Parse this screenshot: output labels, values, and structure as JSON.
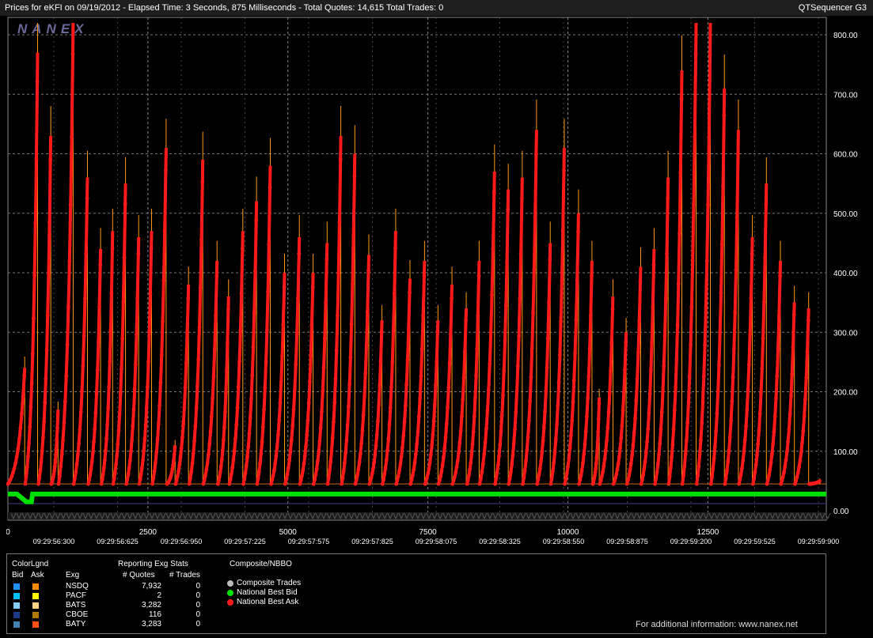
{
  "header": {
    "title": "Prices for  eKFI  on  09/19/2012  -  Elapsed Time: 3 Seconds, 875 Milliseconds  -  Total Quotes: 14,615  Total Trades: 0",
    "app": "QTSequencer G3"
  },
  "brand": {
    "logo": "NANEX"
  },
  "chart_data": {
    "type": "line",
    "title": "",
    "xlabel": "",
    "ylabel": "",
    "ylim": [
      0,
      820
    ],
    "xlim": [
      0,
      14615
    ],
    "yticks": [
      "0.00",
      "100.00",
      "200.00",
      "300.00",
      "400.00",
      "500.00",
      "600.00",
      "700.00",
      "800.00"
    ],
    "xticks_top": [
      "0",
      "2500",
      "5000",
      "7500",
      "10000",
      "12500"
    ],
    "xticks_time": [
      "09:29:56:300",
      "09:29:56:625",
      "09:29:56:950",
      "09:29:57:225",
      "09:29:57:575",
      "09:29:57:825",
      "09:29:58:075",
      "09:29:58:325",
      "09:29:58:550",
      "09:29:58:875",
      "09:29:59:200",
      "09:29:59:525",
      "09:29:59:900"
    ],
    "series": [
      {
        "name": "National Best Ask",
        "color": "#ff1a1a",
        "note_type": "sawtooth",
        "cycles": [
          {
            "start": 0,
            "end": 300,
            "peak": 240
          },
          {
            "start": 310,
            "end": 530,
            "peak": 770
          },
          {
            "start": 545,
            "end": 765,
            "peak": 630
          },
          {
            "start": 775,
            "end": 895,
            "peak": 170
          },
          {
            "start": 905,
            "end": 1165,
            "peak": 820
          },
          {
            "start": 1175,
            "end": 1420,
            "peak": 560
          },
          {
            "start": 1435,
            "end": 1655,
            "peak": 440
          },
          {
            "start": 1670,
            "end": 1870,
            "peak": 470
          },
          {
            "start": 1880,
            "end": 2100,
            "peak": 550
          },
          {
            "start": 2115,
            "end": 2335,
            "peak": 460
          },
          {
            "start": 2345,
            "end": 2565,
            "peak": 470
          },
          {
            "start": 2580,
            "end": 2825,
            "peak": 610
          },
          {
            "start": 2840,
            "end": 2985,
            "peak": 110
          },
          {
            "start": 2995,
            "end": 3225,
            "peak": 380
          },
          {
            "start": 3240,
            "end": 3480,
            "peak": 590
          },
          {
            "start": 3490,
            "end": 3735,
            "peak": 420
          },
          {
            "start": 3750,
            "end": 3940,
            "peak": 360
          },
          {
            "start": 3955,
            "end": 4195,
            "peak": 470
          },
          {
            "start": 4205,
            "end": 4440,
            "peak": 520
          },
          {
            "start": 4450,
            "end": 4685,
            "peak": 580
          },
          {
            "start": 4700,
            "end": 4940,
            "peak": 400
          },
          {
            "start": 4950,
            "end": 5205,
            "peak": 460
          },
          {
            "start": 5215,
            "end": 5450,
            "peak": 400
          },
          {
            "start": 5460,
            "end": 5700,
            "peak": 450
          },
          {
            "start": 5710,
            "end": 5945,
            "peak": 630
          },
          {
            "start": 5960,
            "end": 6195,
            "peak": 600
          },
          {
            "start": 6205,
            "end": 6445,
            "peak": 430
          },
          {
            "start": 6455,
            "end": 6680,
            "peak": 320
          },
          {
            "start": 6690,
            "end": 6925,
            "peak": 470
          },
          {
            "start": 6935,
            "end": 7180,
            "peak": 390
          },
          {
            "start": 7190,
            "end": 7440,
            "peak": 420
          },
          {
            "start": 7450,
            "end": 7680,
            "peak": 320
          },
          {
            "start": 7690,
            "end": 7930,
            "peak": 380
          },
          {
            "start": 7940,
            "end": 8185,
            "peak": 340
          },
          {
            "start": 8200,
            "end": 8415,
            "peak": 420
          },
          {
            "start": 8425,
            "end": 8690,
            "peak": 570
          },
          {
            "start": 8700,
            "end": 8935,
            "peak": 540
          },
          {
            "start": 8945,
            "end": 9185,
            "peak": 560
          },
          {
            "start": 9195,
            "end": 9440,
            "peak": 640
          },
          {
            "start": 9450,
            "end": 9685,
            "peak": 450
          },
          {
            "start": 9695,
            "end": 9935,
            "peak": 610
          },
          {
            "start": 9945,
            "end": 10190,
            "peak": 500
          },
          {
            "start": 10200,
            "end": 10430,
            "peak": 420
          },
          {
            "start": 10445,
            "end": 10560,
            "peak": 190
          },
          {
            "start": 10570,
            "end": 10805,
            "peak": 360
          },
          {
            "start": 10815,
            "end": 11040,
            "peak": 300
          },
          {
            "start": 11055,
            "end": 11300,
            "peak": 410
          },
          {
            "start": 11310,
            "end": 11540,
            "peak": 440
          },
          {
            "start": 11555,
            "end": 11790,
            "peak": 560
          },
          {
            "start": 11800,
            "end": 12035,
            "peak": 740
          },
          {
            "start": 12045,
            "end": 12290,
            "peak": 820
          },
          {
            "start": 12300,
            "end": 12545,
            "peak": 820
          },
          {
            "start": 12555,
            "end": 12795,
            "peak": 710
          },
          {
            "start": 12805,
            "end": 13045,
            "peak": 640
          },
          {
            "start": 13055,
            "end": 13295,
            "peak": 460
          },
          {
            "start": 13305,
            "end": 13545,
            "peak": 550
          },
          {
            "start": 13555,
            "end": 13795,
            "peak": 420
          },
          {
            "start": 13805,
            "end": 14045,
            "peak": 350
          },
          {
            "start": 14055,
            "end": 14300,
            "peak": 340
          },
          {
            "start": 14310,
            "end": 14500,
            "peak": 50
          }
        ]
      },
      {
        "name": "National Best Bid",
        "color": "#00e000",
        "level": 28,
        "early_level": 15
      }
    ],
    "vgrid_at": [
      2500,
      5000,
      7500,
      10000,
      12500
    ],
    "hline_orange": 45,
    "hline_blue": 12,
    "grid": true
  },
  "legend": {
    "colorlgnd": "ColorLgnd",
    "bid_hdr": "Bid",
    "ask_hdr": "Ask",
    "exg_hdr": "Exg",
    "reporting": "Reporting Exg Stats",
    "quotes_hdr": "# Quotes",
    "trades_hdr": "# Trades",
    "composite_hdr": "Composite/NBBO",
    "rows": [
      {
        "exg": "NSDQ",
        "quotes": "7,932",
        "trades": "0",
        "bid": "#1e90ff",
        "ask": "#ff8c00"
      },
      {
        "exg": "PACF",
        "quotes": "2",
        "trades": "0",
        "bid": "#00bfff",
        "ask": "#ffff00"
      },
      {
        "exg": "BATS",
        "quotes": "3,282",
        "trades": "0",
        "bid": "#87cefa",
        "ask": "#ffd27f"
      },
      {
        "exg": "CBOE",
        "quotes": "116",
        "trades": "0",
        "bid": "#1e3c8c",
        "ask": "#b07800"
      },
      {
        "exg": "BATY",
        "quotes": "3,283",
        "trades": "0",
        "bid": "#4682b4",
        "ask": "#ff5014"
      }
    ],
    "composite": [
      {
        "label": "Composite Trades",
        "color": "#bbbbbb"
      },
      {
        "label": "National Best Bid",
        "color": "#00e000"
      },
      {
        "label": "National Best Ask",
        "color": "#ff1a1a"
      }
    ],
    "info": "For additional information: www.nanex.net"
  }
}
